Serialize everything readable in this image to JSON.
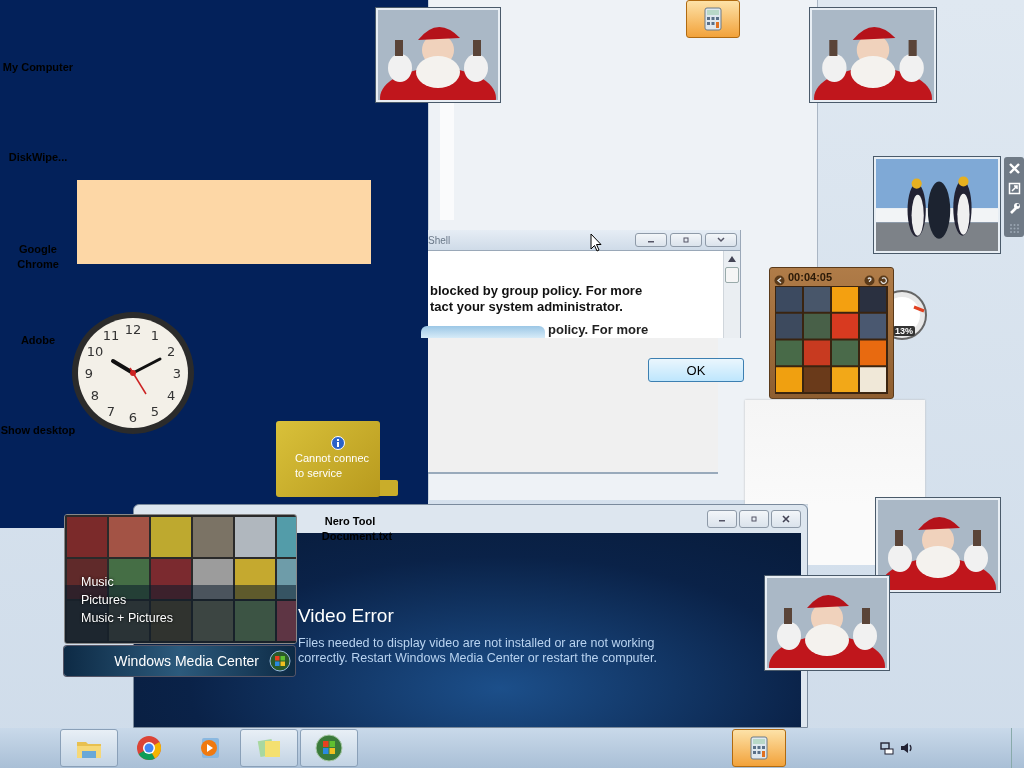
{
  "desktop_icons": [
    {
      "label": "My Computer"
    },
    {
      "label": "DiskWipe..."
    },
    {
      "label": "Google Chrome"
    },
    {
      "label": "Adobe"
    },
    {
      "label": "Show desktop"
    },
    {
      "label": "Nero Tool"
    },
    {
      "label": "Document.txt"
    }
  ],
  "clock": {
    "numerals": [
      "11",
      "12",
      "1",
      "10",
      "2",
      "9",
      "3",
      "8",
      "4",
      "7",
      "5",
      "6"
    ]
  },
  "weather_gadget": {
    "lines": [
      "Cannot connec",
      "to service"
    ]
  },
  "puzzle_gadget": {
    "time": "00:04:05"
  },
  "cpu_meter": {
    "reading": "13%"
  },
  "shell_window": {
    "title": "Shell",
    "lines": [
      "blocked by group policy. For more",
      "tact your system administrator."
    ],
    "ghost_line": "policy. For more"
  },
  "dialog": {
    "button": "OK"
  },
  "media_center": {
    "title": "Video Error",
    "message": "Files needed to display video are not installed or are not working correctly. Restart Windows Media Center or restart the computer."
  },
  "media_center_preview": {
    "items": [
      "Music",
      "Pictures",
      "Music + Pictures"
    ],
    "label": "Windows Media Center"
  },
  "top_button": {
    "kind": "calculator",
    "selected": true
  },
  "taskbar": {
    "buttons": [
      {
        "kind": "folder",
        "selected": false
      },
      {
        "kind": "chrome",
        "selected": false
      },
      {
        "kind": "player",
        "selected": false
      },
      {
        "kind": "notes",
        "selected": false
      },
      {
        "kind": "windows",
        "selected": false
      },
      {
        "kind": "calculator",
        "selected": true
      }
    ]
  }
}
